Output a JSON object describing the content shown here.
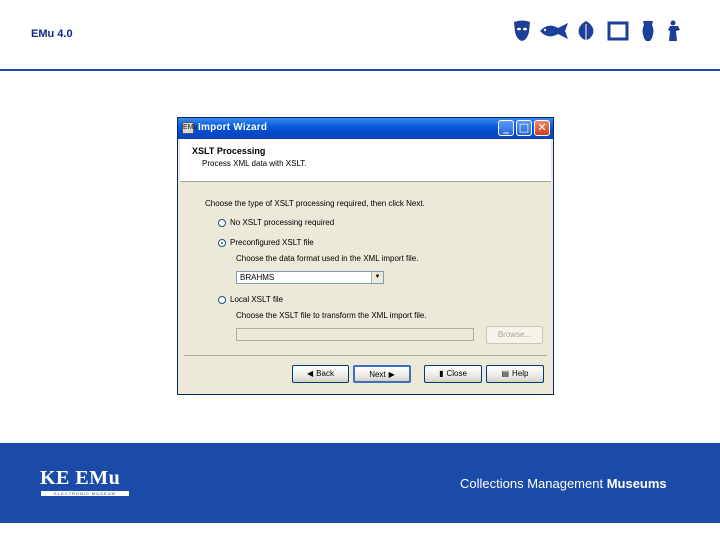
{
  "slide": {
    "title": "EMu 4.0",
    "header_icons": [
      "mask-icon",
      "fish-icon",
      "leaf-icon",
      "frame-icon",
      "vase-icon",
      "figure-icon"
    ]
  },
  "dialog": {
    "app_icon": "EMu",
    "title": "Import Wizard",
    "controls": {
      "minimize": "_",
      "maximize": "□",
      "close": "✕"
    },
    "banner_title": "XSLT Processing",
    "banner_subtitle": "Process XML data with XSLT.",
    "instruction": "Choose the type of XSLT processing required, then click Next.",
    "options": [
      {
        "label": "No XSLT processing required",
        "selected": false
      },
      {
        "label": "Preconfigured XSLT file",
        "selected": true
      },
      {
        "label": "Local XSLT file",
        "selected": false
      }
    ],
    "preconfigured_hint": "Choose the data format used in the XML import file.",
    "preconfigured_value": "BRAHMS",
    "local_hint": "Choose the XSLT file to transform the XML import file.",
    "browse_label": "Browse...",
    "buttons": {
      "back": "Back",
      "next": "Next",
      "close": "Close",
      "help": "Help"
    }
  },
  "footer": {
    "brand": "KE EMu",
    "brand_sub": "ELECTRONIC MUSEUM",
    "tagline_regular": "Collections Management ",
    "tagline_bold": "Museums"
  },
  "colors": {
    "brand_blue": "#1c4aa8",
    "title_blue": "#0d2a8a",
    "dialog_bg": "#ece9d8",
    "titlebar_blue": "#0548c8"
  }
}
